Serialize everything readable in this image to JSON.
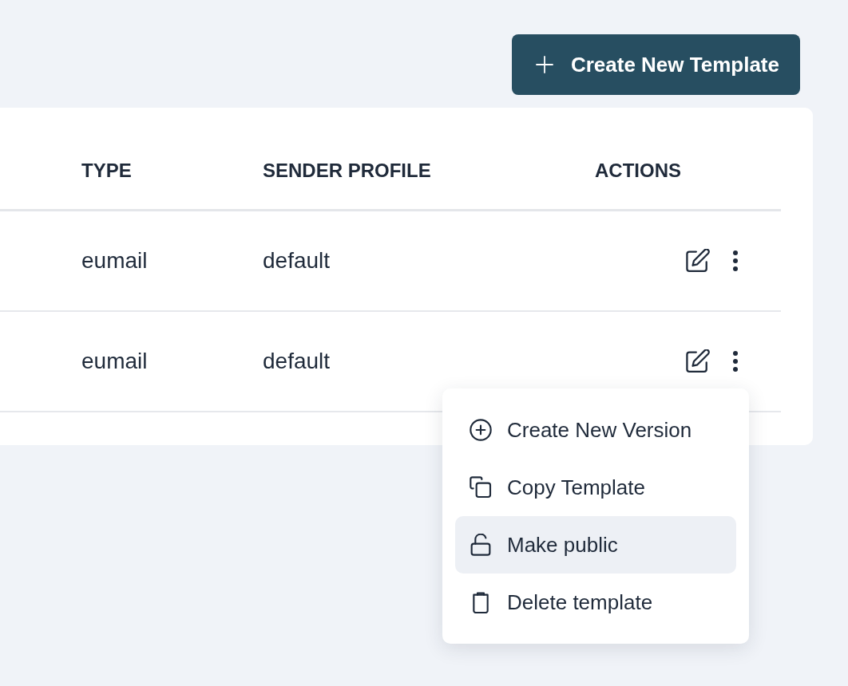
{
  "toolbar": {
    "create_button": {
      "label": "Create New Template"
    }
  },
  "table": {
    "columns": [
      {
        "label": "TYPE"
      },
      {
        "label": "SENDER PROFILE"
      },
      {
        "label": "ACTIONS"
      }
    ],
    "rows": [
      {
        "type": "eumail",
        "sender_profile": "default"
      },
      {
        "type": "eumail",
        "sender_profile": "default"
      }
    ]
  },
  "context_menu": {
    "items": [
      {
        "kind": "add",
        "label": "Create New Version",
        "highlighted": false
      },
      {
        "kind": "copy",
        "label": "Copy Template",
        "highlighted": false
      },
      {
        "kind": "unlock",
        "label": "Make public",
        "highlighted": true
      },
      {
        "kind": "delete",
        "label": "Delete template",
        "highlighted": false
      }
    ]
  }
}
